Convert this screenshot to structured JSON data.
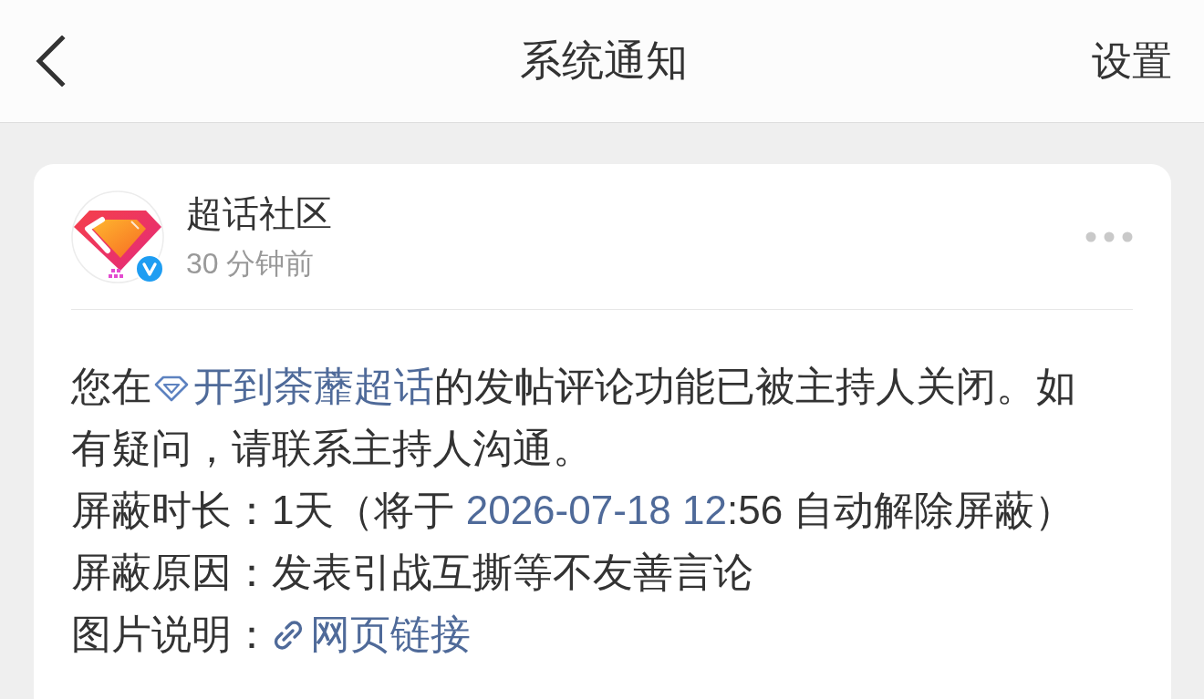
{
  "header": {
    "title": "系统通知",
    "action": "设置"
  },
  "notification": {
    "sender": {
      "name": "超话社区",
      "verified": true,
      "time": "30 分钟前"
    },
    "message": [
      {
        "kind": "text",
        "text": "您在"
      },
      {
        "kind": "topic_link",
        "text": "开到荼蘼超话"
      },
      {
        "kind": "text",
        "text": "的发帖评论功能已被主持人关闭。如有疑问，请联系主持人沟通。"
      }
    ],
    "details": [
      {
        "label": "屏蔽时长：",
        "value": [
          {
            "kind": "text",
            "text": "1天（将于 "
          },
          {
            "kind": "date_link",
            "text": "2026-07-18 12"
          },
          {
            "kind": "text",
            "text": ":56 自动解除屏蔽）"
          }
        ]
      },
      {
        "label": "屏蔽原因：",
        "value": [
          {
            "kind": "text",
            "text": "发表引战互撕等不友善言论"
          }
        ]
      },
      {
        "label": "图片说明：",
        "value": [
          {
            "kind": "web_link",
            "text": "网页链接"
          }
        ]
      }
    ]
  }
}
